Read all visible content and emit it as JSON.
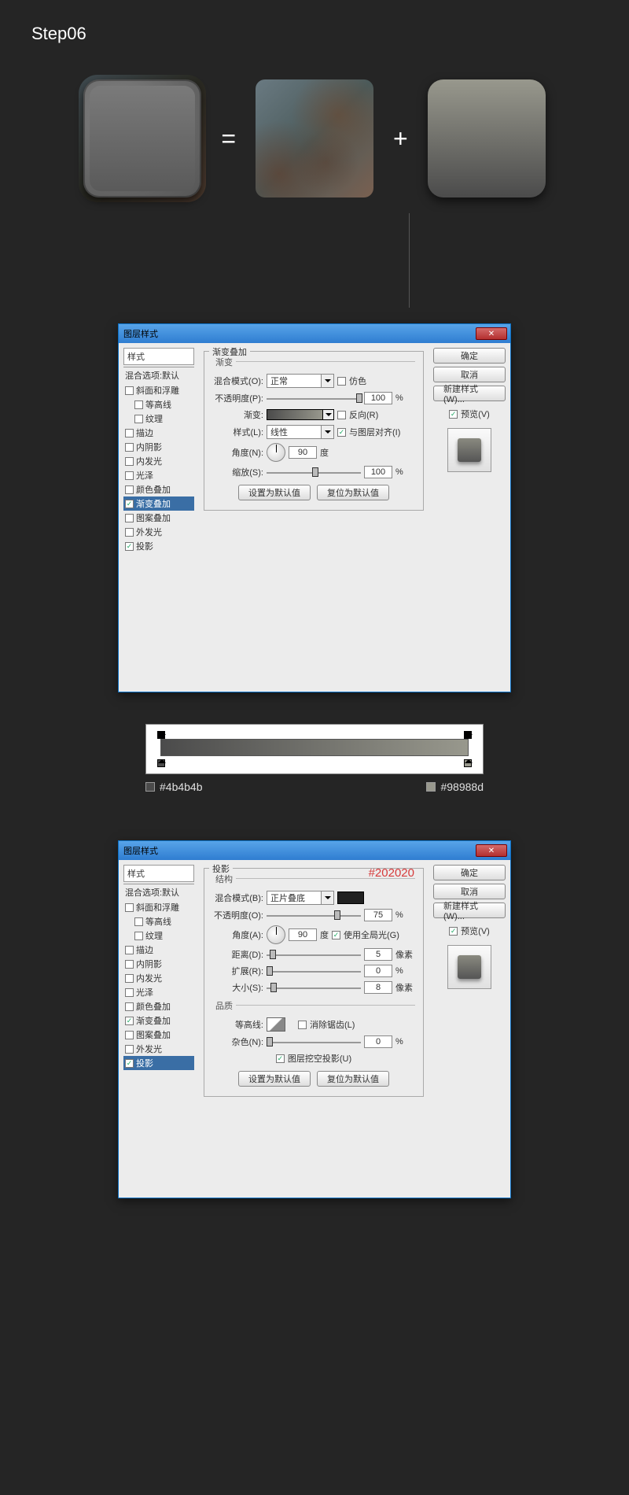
{
  "step_title": "Step06",
  "operators": {
    "equals": "=",
    "plus": "+"
  },
  "gradient_colors": {
    "left": "#4b4b4b",
    "right": "#98988d"
  },
  "shadow_color_annot": "#202020",
  "dialog_common": {
    "title": "图层样式",
    "close_x": "✕",
    "styles_header": "样式",
    "blend_options": "混合选项:默认",
    "btn_ok": "确定",
    "btn_cancel": "取消",
    "btn_newstyle": "新建样式(W)...",
    "preview_label": "预览(V)",
    "btn_set_default": "设置为默认值",
    "btn_reset_default": "复位为默认值"
  },
  "style_list_a": [
    {
      "label": "斜面和浮雕",
      "checked": false
    },
    {
      "label": "等高线",
      "checked": false,
      "indent": true
    },
    {
      "label": "纹理",
      "checked": false,
      "indent": true
    },
    {
      "label": "描边",
      "checked": false
    },
    {
      "label": "内阴影",
      "checked": false
    },
    {
      "label": "内发光",
      "checked": false
    },
    {
      "label": "光泽",
      "checked": false
    },
    {
      "label": "颜色叠加",
      "checked": false
    },
    {
      "label": "渐变叠加",
      "checked": true,
      "selected": true
    },
    {
      "label": "图案叠加",
      "checked": false
    },
    {
      "label": "外发光",
      "checked": false
    },
    {
      "label": "投影",
      "checked": true
    }
  ],
  "style_list_b": [
    {
      "label": "斜面和浮雕",
      "checked": false
    },
    {
      "label": "等高线",
      "checked": false,
      "indent": true
    },
    {
      "label": "纹理",
      "checked": false,
      "indent": true
    },
    {
      "label": "描边",
      "checked": false
    },
    {
      "label": "内阴影",
      "checked": false
    },
    {
      "label": "内发光",
      "checked": false
    },
    {
      "label": "光泽",
      "checked": false
    },
    {
      "label": "颜色叠加",
      "checked": false
    },
    {
      "label": "渐变叠加",
      "checked": true
    },
    {
      "label": "图案叠加",
      "checked": false
    },
    {
      "label": "外发光",
      "checked": false
    },
    {
      "label": "投影",
      "checked": true,
      "selected": true
    }
  ],
  "grad_overlay": {
    "title": "渐变叠加",
    "sub_title": "渐变",
    "blend_mode_lbl": "混合模式(O):",
    "blend_mode_val": "正常",
    "dither_lbl": "仿色",
    "opacity_lbl": "不透明度(P):",
    "opacity_val": "100",
    "pct": "%",
    "gradient_lbl": "渐变:",
    "reverse_lbl": "反向(R)",
    "style_lbl": "样式(L):",
    "style_val": "线性",
    "align_lbl": "与图层对齐(I)",
    "angle_lbl": "角度(N):",
    "angle_val": "90",
    "deg": "度",
    "scale_lbl": "缩放(S):",
    "scale_val": "100"
  },
  "drop_shadow": {
    "title": "投影",
    "struct": "结构",
    "blend_mode_lbl": "混合模式(B):",
    "blend_mode_val": "正片叠底",
    "opacity_lbl": "不透明度(O):",
    "opacity_val": "75",
    "pct": "%",
    "angle_lbl": "角度(A):",
    "angle_val": "90",
    "deg": "度",
    "global_lbl": "使用全局光(G)",
    "distance_lbl": "距离(D):",
    "distance_val": "5",
    "px": "像素",
    "spread_lbl": "扩展(R):",
    "spread_val": "0",
    "size_lbl": "大小(S):",
    "size_val": "8",
    "quality": "品质",
    "contour_lbl": "等高线:",
    "antialias_lbl": "消除锯齿(L)",
    "noise_lbl": "杂色(N):",
    "noise_val": "0",
    "knockout_lbl": "图层挖空投影(U)"
  }
}
